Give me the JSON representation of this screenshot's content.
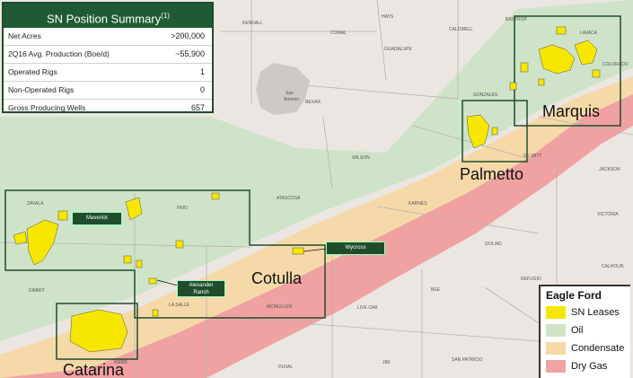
{
  "summary": {
    "title": "SN Position Summary",
    "title_sup": "(1)",
    "rows": [
      {
        "label": "Net Acres",
        "value": ">200,000"
      },
      {
        "label": "2Q16 Avg. Production (Boe/d)",
        "value": "~55,900"
      },
      {
        "label": "Operated Rigs",
        "value": "1"
      },
      {
        "label": "Non-Operated Rigs",
        "value": "0"
      },
      {
        "label": "Gross Producing Wells",
        "value": "657"
      }
    ]
  },
  "legend": {
    "title": "Eagle Ford",
    "items": [
      {
        "label": "SN Leases",
        "color": "#f6e600"
      },
      {
        "label": "Oil",
        "color": "#cfe3c8"
      },
      {
        "label": "Condensate",
        "color": "#f6d9a8"
      },
      {
        "label": "Dry Gas",
        "color": "#f0a2a2"
      }
    ]
  },
  "areas": {
    "marquis": "Marquis",
    "palmetto": "Palmetto",
    "cotulla": "Cotulla",
    "catarina": "Catarina"
  },
  "tags": {
    "maverick": "Maverick",
    "alexander_1": "Alexander",
    "alexander_2": "Ranch",
    "wycross": "Wycross"
  },
  "counties": {
    "kendall": "KENDALL",
    "comal": "COMAL",
    "hays": "HAYS",
    "caldwell": "CALDWELL",
    "guadalupe": "GUADALUPE",
    "bastrop": "BASTROP",
    "lavaca": "LAVACA",
    "colorado": "COLORADO",
    "gonzales": "GONZALES",
    "bexar": "BEXAR",
    "san_antonio_1": "San",
    "san_antonio_2": "Antonio",
    "wilson": "WILSON",
    "dewitt": "DE WITT",
    "jackson": "JACKSON",
    "zavala": "ZAVALA",
    "frio": "FRIO",
    "atascosa": "ATASCOSA",
    "karnes": "KARNES",
    "victoria": "VICTORIA",
    "goliad": "GOLIAD",
    "dimmit": "DIMMIT",
    "la_salle": "LA SALLE",
    "mcmullen": "MCMULLEN",
    "live_oak": "LIVE OAK",
    "bee": "BEE",
    "refugio": "REFUGIO",
    "webb": "WEBB",
    "duval": "DUVAL",
    "jim_wells": "JIM",
    "san_patricio": "SAN PATRICIO",
    "calhoun": "CALHOUN"
  }
}
